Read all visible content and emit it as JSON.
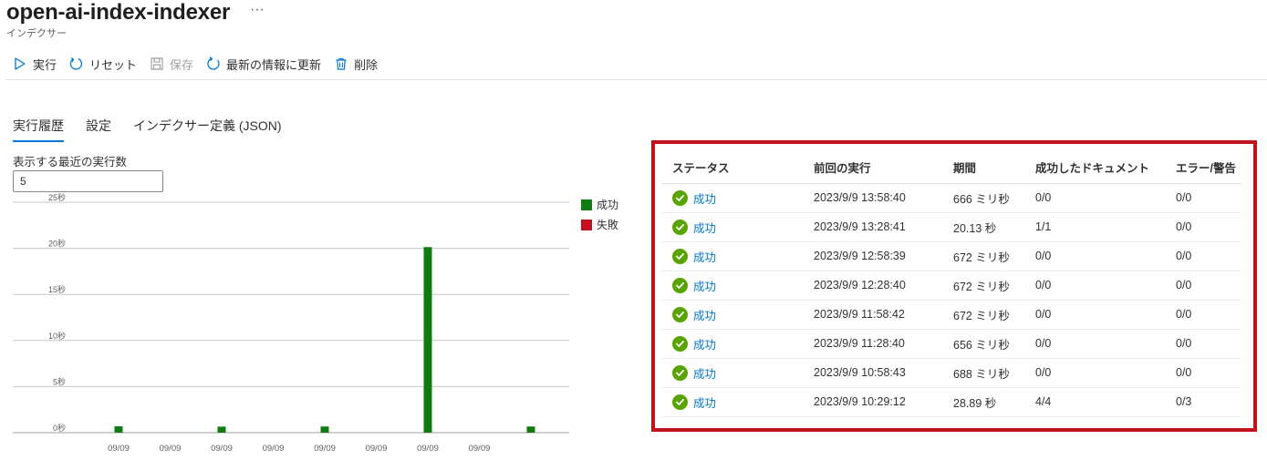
{
  "header": {
    "title": "open-ai-index-indexer",
    "more": "···",
    "subtitle": "インデクサー"
  },
  "toolbar": {
    "run_label": "実行",
    "reset_label": "リセット",
    "save_label": "保存",
    "refresh_label": "最新の情報に更新",
    "delete_label": "削除"
  },
  "tabs": [
    {
      "label": "実行履歴",
      "active": true
    },
    {
      "label": "設定",
      "active": false
    },
    {
      "label": "インデクサー定義 (JSON)",
      "active": false
    }
  ],
  "run_count": {
    "label": "表示する最近の実行数",
    "value": "5"
  },
  "colors": {
    "success": "#107c10",
    "failure": "#c50f1f",
    "accent": "#0078d4",
    "status_check": "#57a300"
  },
  "chart_data": {
    "type": "bar",
    "categories": [
      "09/09",
      "09/09",
      "09/09",
      "09/09",
      "09/09",
      "09/09",
      "09/09",
      "09/09",
      "09/09",
      "09/09"
    ],
    "tick_labels": [
      "09/09",
      "09/09",
      "09/09",
      "09/09",
      "09/09",
      "09/09",
      "09/09",
      "09/09"
    ],
    "series": [
      {
        "name": "成功",
        "color": "#107c10",
        "values": [
          0.688,
          null,
          0.656,
          null,
          0.672,
          null,
          20.13,
          null,
          0.672,
          null
        ]
      },
      {
        "name": "失敗",
        "color": "#c50f1f",
        "values": [
          null,
          null,
          null,
          null,
          null,
          null,
          null,
          null,
          null,
          null
        ]
      }
    ],
    "yticks": [
      "0秒",
      "5秒",
      "10秒",
      "15秒",
      "20秒",
      "25秒"
    ],
    "ylim": [
      0,
      25
    ],
    "grid": true,
    "legend": "right"
  },
  "table": {
    "columns": [
      "ステータス",
      "前回の実行",
      "期間",
      "成功したドキュメント",
      "エラー/警告"
    ],
    "rows": [
      {
        "status": "成功",
        "last_run": "2023/9/9 13:58:40",
        "duration": "666 ミリ秒",
        "docs": "0/0",
        "errors": "0/0"
      },
      {
        "status": "成功",
        "last_run": "2023/9/9 13:28:41",
        "duration": "20.13 秒",
        "docs": "1/1",
        "errors": "0/0"
      },
      {
        "status": "成功",
        "last_run": "2023/9/9 12:58:39",
        "duration": "672 ミリ秒",
        "docs": "0/0",
        "errors": "0/0"
      },
      {
        "status": "成功",
        "last_run": "2023/9/9 12:28:40",
        "duration": "672 ミリ秒",
        "docs": "0/0",
        "errors": "0/0"
      },
      {
        "status": "成功",
        "last_run": "2023/9/9 11:58:42",
        "duration": "672 ミリ秒",
        "docs": "0/0",
        "errors": "0/0"
      },
      {
        "status": "成功",
        "last_run": "2023/9/9 11:28:40",
        "duration": "656 ミリ秒",
        "docs": "0/0",
        "errors": "0/0"
      },
      {
        "status": "成功",
        "last_run": "2023/9/9 10:58:43",
        "duration": "688 ミリ秒",
        "docs": "0/0",
        "errors": "0/0"
      },
      {
        "status": "成功",
        "last_run": "2023/9/9 10:29:12",
        "duration": "28.89 秒",
        "docs": "4/4",
        "errors": "0/3"
      }
    ]
  }
}
